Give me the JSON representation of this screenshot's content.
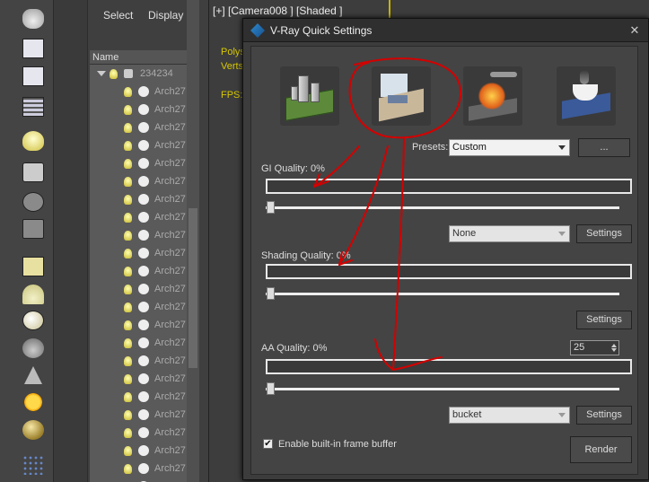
{
  "explorer": {
    "menu": {
      "select": "Select",
      "display": "Display"
    },
    "column_header": "Name",
    "parent_name": "234234",
    "child_name": "Arch27",
    "child_count": 23
  },
  "viewport": {
    "label": "[+] [Camera008 ] [Shaded ]",
    "stats": {
      "polys": "Polys",
      "verts": "Verts",
      "fps": "FPS:"
    }
  },
  "dialog": {
    "title": "V-Ray Quick Settings",
    "close": "✕",
    "presets_label": "Presets:",
    "presets_value": "Custom",
    "presets_more": "...",
    "gi": {
      "label": "GI Quality: 0%",
      "engine": "None",
      "settings": "Settings",
      "level": 0
    },
    "shading": {
      "label": "Shading Quality: 0%",
      "settings": "Settings",
      "level": 0
    },
    "aa": {
      "label": "AA Quality: 0%",
      "spinner": "25",
      "sampler": "bucket",
      "settings": "Settings",
      "level": 0
    },
    "frame_buffer": {
      "label": "Enable built-in frame buffer",
      "checked": true,
      "check_mark": "✔"
    },
    "render_button": "Render"
  },
  "colors": {
    "annotation": "#d40000",
    "viewport_border": "#c8b400"
  }
}
